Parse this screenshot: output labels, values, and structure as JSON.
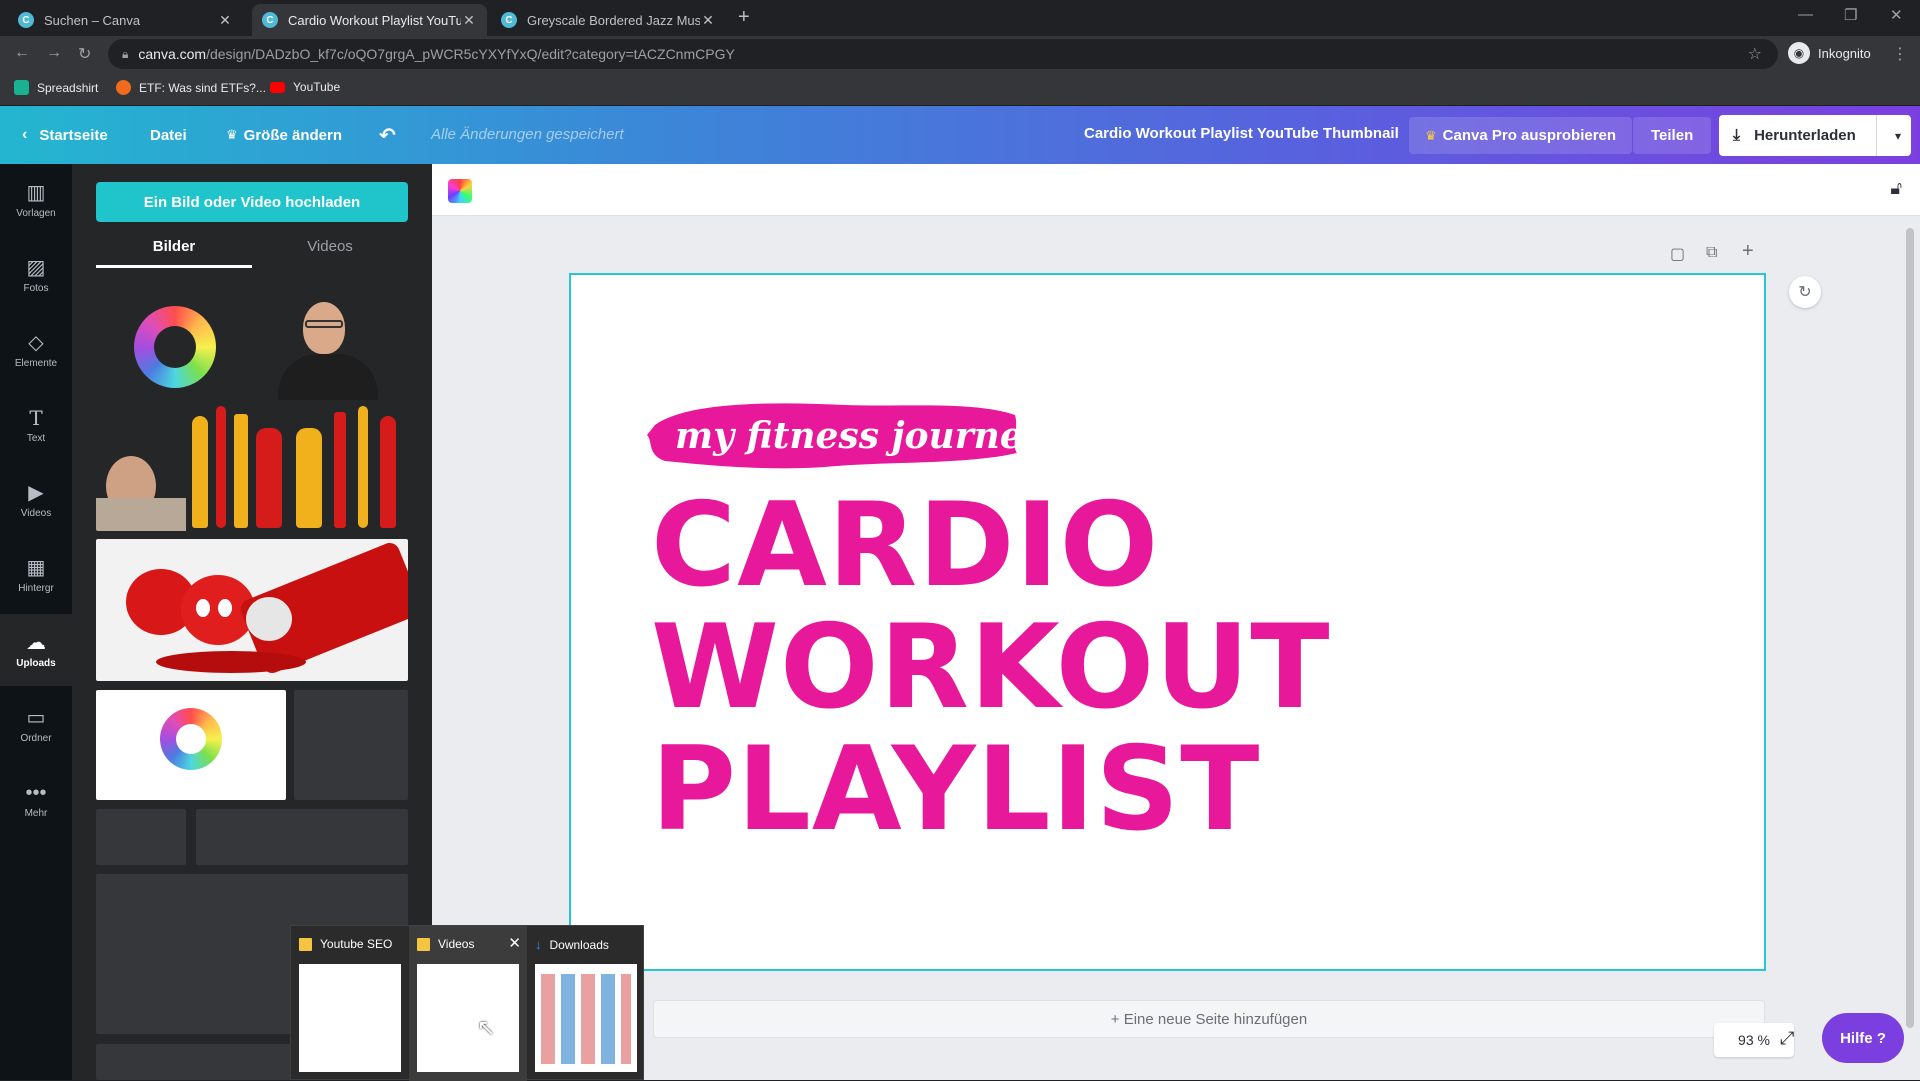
{
  "browser": {
    "tabs": [
      {
        "title": "Suchen – Canva",
        "active": false
      },
      {
        "title": "Cardio Workout Playlist YouTube",
        "active": true
      },
      {
        "title": "Greyscale Bordered Jazz Music Y",
        "active": false
      }
    ],
    "url_host": "canva.com",
    "url_path": "/design/DADzbO_kf7c/oQO7grgA_pWCR5cYXYfYxQ/edit?category=tACZCnmCPGY",
    "profile_label": "Inkognito",
    "bookmarks": [
      "Spreadshirt",
      "ETF: Was sind ETFs?...",
      "YouTube"
    ]
  },
  "header": {
    "home_label": "Startseite",
    "file_label": "Datei",
    "resize_label": "Größe ändern",
    "saved_status": "Alle Änderungen gespeichert",
    "design_title": "Cardio Workout Playlist YouTube Thumbnail",
    "pro_label": "Canva Pro ausprobieren",
    "share_label": "Teilen",
    "download_label": "Herunterladen"
  },
  "rail": [
    {
      "label": "Vorlagen",
      "icon": "templates-icon"
    },
    {
      "label": "Fotos",
      "icon": "photos-icon"
    },
    {
      "label": "Elemente",
      "icon": "elements-icon"
    },
    {
      "label": "Text",
      "icon": "text-icon"
    },
    {
      "label": "Videos",
      "icon": "videos-icon"
    },
    {
      "label": "Hintergr",
      "icon": "background-icon"
    },
    {
      "label": "Uploads",
      "icon": "uploads-icon",
      "active": true
    },
    {
      "label": "Ordner",
      "icon": "folder-icon"
    },
    {
      "label": "Mehr",
      "icon": "more-icon"
    }
  ],
  "panel": {
    "upload_label": "Ein Bild oder Video hochladen",
    "tabs": [
      "Bilder",
      "Videos"
    ],
    "active_tab": "Bilder"
  },
  "canvas": {
    "tagline": "my fitness journey",
    "headline": [
      "CARDIO",
      "WORKOUT",
      "PLAYLIST"
    ],
    "headline_color": "#e8189a",
    "accent_border": "#28c5d6"
  },
  "editor": {
    "add_page_label": "+ Eine neue Seite hinzufügen",
    "zoom_level": "93 %",
    "help_label": "Hilfe ?"
  },
  "taskbar_preview": [
    {
      "title": "Youtube SEO",
      "icon": "folder-icon"
    },
    {
      "title": "Videos",
      "icon": "folder-icon"
    },
    {
      "title": "Downloads",
      "icon": "download-icon"
    }
  ]
}
